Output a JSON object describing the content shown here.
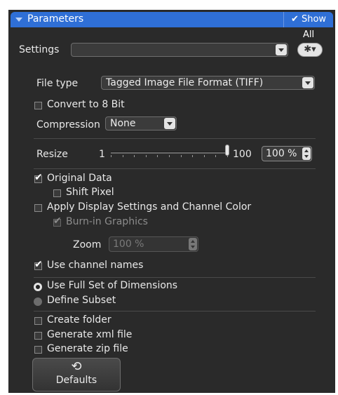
{
  "panel": {
    "title": "Parameters",
    "show_all_label": "✔ Show All"
  },
  "settings": {
    "label": "Settings",
    "value": "",
    "gear_icon": "✱▾"
  },
  "file_type": {
    "label": "File type",
    "value": "Tagged Image File Format (TIFF)"
  },
  "convert_8bit": {
    "label": "Convert to 8 Bit",
    "checked": false
  },
  "compression": {
    "label": "Compression",
    "value": "None"
  },
  "resize": {
    "label": "Resize",
    "min": "1",
    "max": "100",
    "value": "100 %",
    "fraction": 1.0
  },
  "original_data": {
    "label": "Original Data",
    "checked": true
  },
  "shift_pixel": {
    "label": "Shift Pixel",
    "checked": false
  },
  "apply_display": {
    "label": "Apply Display Settings and Channel Color",
    "checked": false
  },
  "burn_in": {
    "label": "Burn-in Graphics",
    "checked": true,
    "disabled": true
  },
  "zoom": {
    "label": "Zoom",
    "value": "100 %",
    "disabled": true
  },
  "use_channel_names": {
    "label": "Use channel names",
    "checked": true
  },
  "dimensions": {
    "full_set_label": "Use Full Set of Dimensions",
    "subset_label": "Define Subset",
    "selected": "full"
  },
  "create_folder": {
    "label": "Create folder",
    "checked": false
  },
  "generate_xml": {
    "label": "Generate xml file",
    "checked": false
  },
  "generate_zip": {
    "label": "Generate zip file",
    "checked": false
  },
  "defaults_button": {
    "icon": "⟲",
    "label": "Defaults"
  }
}
